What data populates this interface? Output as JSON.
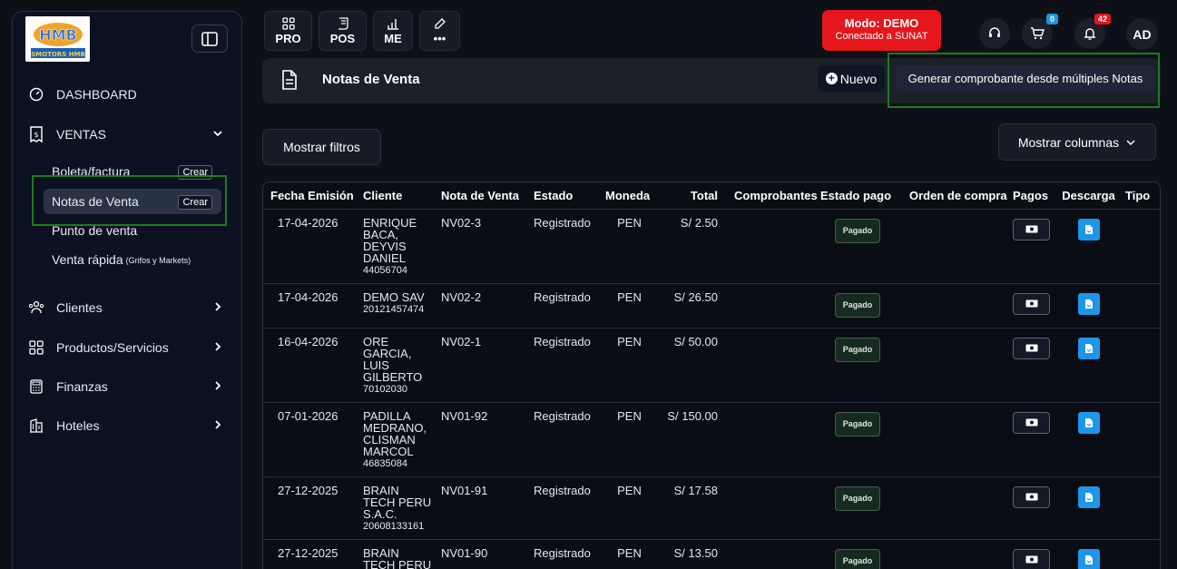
{
  "sidebar": {
    "logo_text": "SMOTORS HMB",
    "items": [
      {
        "label": "DASHBOARD",
        "icon": "dashboard-icon"
      },
      {
        "label": "VENTAS",
        "icon": "receipt-icon"
      },
      {
        "label": "Clientes",
        "icon": "users-icon"
      },
      {
        "label": "Productos/Servicios",
        "icon": "grid-icon"
      },
      {
        "label": "Finanzas",
        "icon": "calculator-icon"
      },
      {
        "label": "Hoteles",
        "icon": "building-icon"
      }
    ],
    "sub_items": [
      {
        "label": "Boleta/factura",
        "badge": "Crear"
      },
      {
        "label": "Notas de Venta",
        "badge": "Crear"
      },
      {
        "label": "Punto de venta"
      },
      {
        "label": "Venta rápida",
        "note": "(Grifos y Markets)"
      }
    ]
  },
  "toolbar": {
    "buttons": [
      "PRO",
      "POS",
      "ME",
      "•••"
    ],
    "mode": {
      "title": "Modo: DEMO",
      "subtitle": "Conectado a SUNAT"
    },
    "cart_count": "0",
    "notif_count": "42",
    "avatar": "AD"
  },
  "header": {
    "title": "Notas de Venta",
    "new_label": "Nuevo",
    "generate_label": "Generar comprobante desde múltiples Notas"
  },
  "filters_label": "Mostrar filtros",
  "columns_label": "Mostrar columnas",
  "table": {
    "columns": [
      "Fecha Emisión",
      "Cliente",
      "Nota de Venta",
      "Estado",
      "Moneda",
      "Total",
      "Comprobantes",
      "Estado pago",
      "Orden de compra",
      "Pagos",
      "Descarga",
      "Tipo"
    ],
    "rows": [
      {
        "fecha": "17-04-2026",
        "cliente": "ENRIQUE BACA, DEYVIS DANIEL",
        "doc": "44056704",
        "nota": "NV02-3",
        "estado": "Registrado",
        "moneda": "PEN",
        "total": "S/ 2.50",
        "pago": "Pagado"
      },
      {
        "fecha": "17-04-2026",
        "cliente": "DEMO SAV",
        "doc": "20121457474",
        "nota": "NV02-2",
        "estado": "Registrado",
        "moneda": "PEN",
        "total": "S/ 26.50",
        "pago": "Pagado"
      },
      {
        "fecha": "16-04-2026",
        "cliente": "ORE GARCIA, LUIS GILBERTO",
        "doc": "70102030",
        "nota": "NV02-1",
        "estado": "Registrado",
        "moneda": "PEN",
        "total": "S/ 50.00",
        "pago": "Pagado"
      },
      {
        "fecha": "07-01-2026",
        "cliente": "PADILLA MEDRANO, CLISMAN MARCOL",
        "doc": "46835084",
        "nota": "NV01-92",
        "estado": "Registrado",
        "moneda": "PEN",
        "total": "S/ 150.00",
        "pago": "Pagado"
      },
      {
        "fecha": "27-12-2025",
        "cliente": "BRAIN TECH PERU S.A.C.",
        "doc": "20608133161",
        "nota": "NV01-91",
        "estado": "Registrado",
        "moneda": "PEN",
        "total": "S/ 17.58",
        "pago": "Pagado"
      },
      {
        "fecha": "27-12-2025",
        "cliente": "BRAIN TECH PERU S.A.C.",
        "doc": "",
        "nota": "NV01-90",
        "estado": "Registrado",
        "moneda": "PEN",
        "total": "S/ 13.50",
        "pago": "Pagado"
      }
    ]
  },
  "colors": {
    "highlight": "#1f7a21",
    "demo": "#e5171c",
    "download": "#1d96e8"
  }
}
